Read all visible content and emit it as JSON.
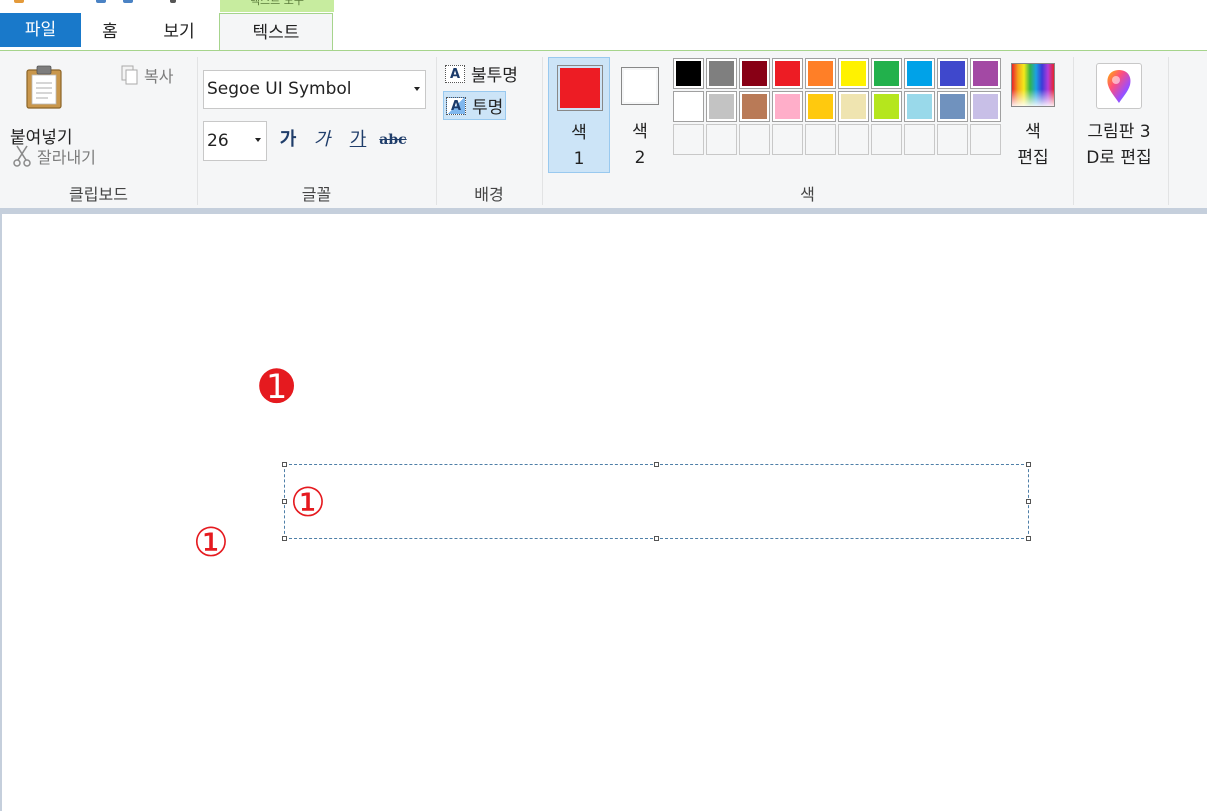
{
  "tabs": {
    "file": "파일",
    "home": "홈",
    "view": "보기",
    "text": "텍스트",
    "context_label": "텍스트 도구"
  },
  "clipboard": {
    "paste": "붙여넣기",
    "cut": "잘라내기",
    "copy": "복사",
    "group_label": "클립보드"
  },
  "font": {
    "family": "Segoe UI Symbol",
    "size": "26",
    "bold": "가",
    "italic": "가",
    "underline": "가",
    "strikethrough": "abc",
    "group_label": "글꼴"
  },
  "background": {
    "opaque": "불투명",
    "transparent": "투명",
    "selected": "transparent",
    "group_label": "배경"
  },
  "colors": {
    "color1_label": "색\n1",
    "color2_label": "색\n2",
    "color1_value": "#ed1c24",
    "color2_value": "#ffffff",
    "edit_label": "색\n편집",
    "group_label": "색",
    "palette_row1": [
      "#000000",
      "#7f7f7f",
      "#880015",
      "#ed1c24",
      "#ff7f27",
      "#fff200",
      "#22b14c",
      "#00a2e8",
      "#3f48cc",
      "#a349a4"
    ],
    "palette_row2": [
      "#ffffff",
      "#c3c3c3",
      "#b97a57",
      "#ffaec9",
      "#ffc90e",
      "#efe4b0",
      "#b5e61d",
      "#99d9ea",
      "#7092be",
      "#c8bfe7"
    ]
  },
  "paint3d": {
    "label": "그림판 3\nD로 편집"
  },
  "canvas": {
    "filled_glyph": "➊",
    "outline_glyph": "①",
    "textbox_glyph": "①",
    "glyph_color": "#e51a1f"
  }
}
